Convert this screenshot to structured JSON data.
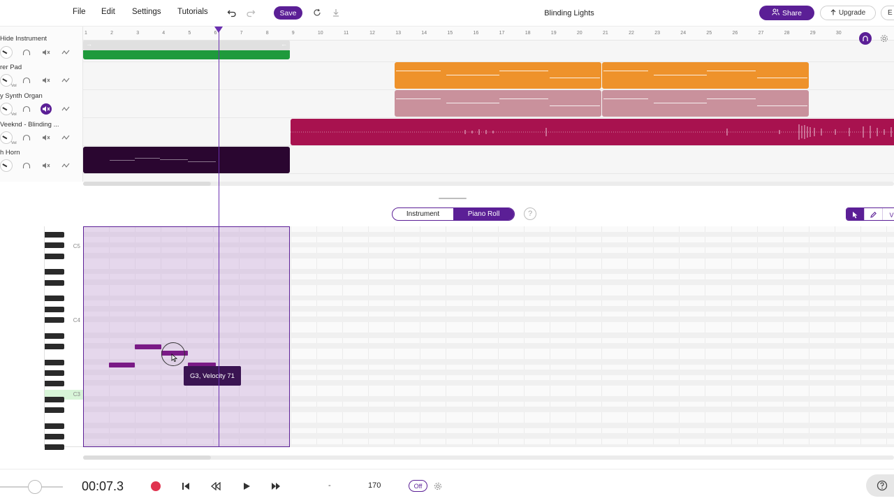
{
  "topbar": {
    "menu": [
      "File",
      "Edit",
      "Settings",
      "Tutorials"
    ],
    "save_label": "Save",
    "song_title": "Blinding Lights",
    "share_label": "Share",
    "upgrade_label": "Upgrade",
    "extra_label": "E"
  },
  "tracks": [
    {
      "name": "Hide Instrument",
      "muted": false
    },
    {
      "name": "rer Pad",
      "muted": false
    },
    {
      "name": "y Synth Organ",
      "muted": true
    },
    {
      "name": "Veeknd - Blinding ...",
      "muted": false
    },
    {
      "name": "h Horn",
      "muted": false
    }
  ],
  "vol_label": "Vol",
  "ruler_ticks": [
    "1",
    "2",
    "3",
    "4",
    "5",
    "6",
    "7",
    "8",
    "9",
    "10",
    "11",
    "12",
    "13",
    "14",
    "15",
    "16",
    "17",
    "18",
    "19",
    "20",
    "21",
    "22",
    "23",
    "24",
    "25",
    "26",
    "27",
    "28",
    "29",
    "30"
  ],
  "colors": {
    "accent": "#5b1f96",
    "green_clip": "#1f9a3c",
    "orange_clip": "#ee922b",
    "pink_clip": "#c9919c",
    "magenta_clip": "#a8124f",
    "dark_clip": "#2a0630",
    "note": "#7a1a86"
  },
  "panel": {
    "tab_instrument": "Instrument",
    "tab_piano_roll": "Piano Roll",
    "help_glyph": "?",
    "tool_last": "V"
  },
  "keyboard_labels": {
    "c5": "C5",
    "c4": "C4",
    "c3": "C3"
  },
  "tooltip": "G3, Velocity 71",
  "transport": {
    "time": "00:07.3",
    "tempo_dash": "-",
    "tempo": "170",
    "metronome": "Off"
  }
}
